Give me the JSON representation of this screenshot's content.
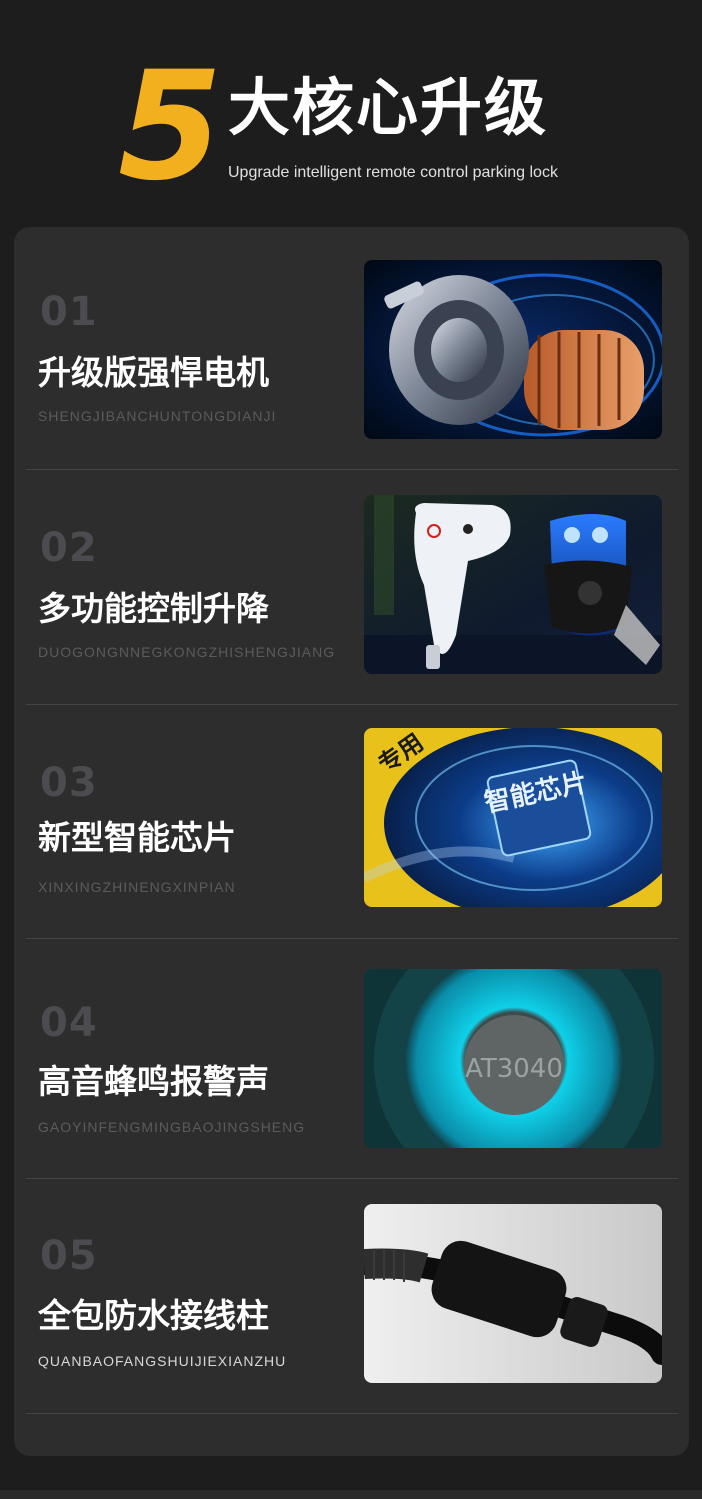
{
  "header": {
    "number": "5",
    "title": "大核心升级",
    "subtitle": "Upgrade intelligent remote control parking lock"
  },
  "features": [
    {
      "number": "01",
      "title": "升级版强悍电机",
      "pinyin": "SHENGJIBANCHUNTONGDIANJI",
      "image": "electric-motor-image"
    },
    {
      "number": "02",
      "title": "多功能控制升降",
      "pinyin": "DUOGONGNNEGKONGZHISHENGJIANG",
      "image": "remote-controls-image"
    },
    {
      "number": "03",
      "title": "新型智能芯片",
      "pinyin": "XINXINGZHINENGXINPIAN",
      "image": "smart-chip-image",
      "image_text": "智能芯片",
      "image_side_text": "专用"
    },
    {
      "number": "04",
      "title": "高音蜂鸣报警声",
      "pinyin": "GAOYINFENGMINGBAOJINGSHENG",
      "image": "buzzer-image",
      "image_text": "AT3040"
    },
    {
      "number": "05",
      "title": "全包防水接线柱",
      "pinyin": "QUANBAOFANGSHUIJIEXIANZHU",
      "image": "waterproof-connector-image"
    }
  ],
  "colors": {
    "accent": "#f2b01e",
    "background": "#1d1d1d",
    "card": "#2d2d2d",
    "number": "#4c4c50"
  }
}
